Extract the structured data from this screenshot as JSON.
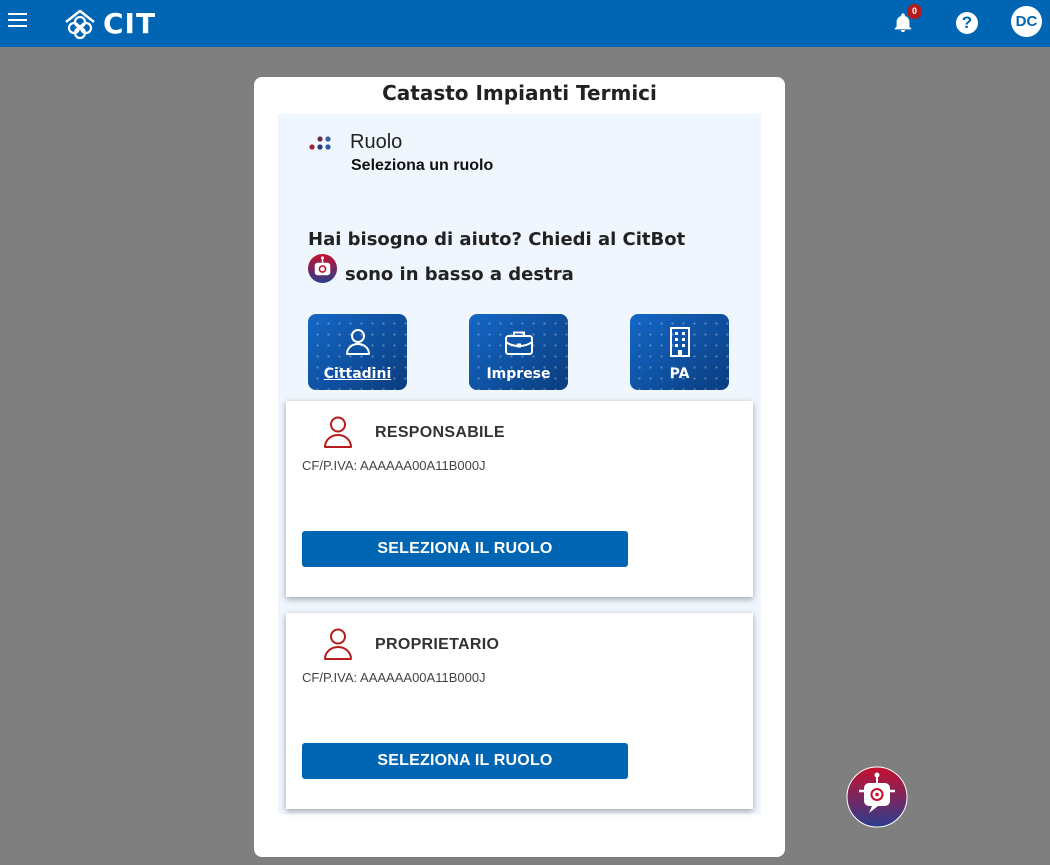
{
  "header": {
    "logo_text": "CIT",
    "notifications_count": "0",
    "help_label": "?",
    "user_initials": "DC"
  },
  "panel": {
    "title": "Catasto Impianti Termici",
    "ruolo_title": "Ruolo",
    "ruolo_subtitle": "Seleziona un ruolo",
    "help_line1": "Hai bisogno di aiuto? Chiedi al CitBot",
    "help_line2": "sono in basso a destra"
  },
  "categories": [
    {
      "label": "Cittadini",
      "icon": "person-icon",
      "active": true
    },
    {
      "label": "Imprese",
      "icon": "briefcase-icon",
      "active": false
    },
    {
      "label": "PA",
      "icon": "building-icon",
      "active": false
    }
  ],
  "roles": [
    {
      "name": "RESPONSABILE",
      "cf": "CF/P.IVA: AAAAAA00A11B000J",
      "button": "SELEZIONA IL RUOLO"
    },
    {
      "name": "PROPRIETARIO",
      "cf": "CF/P.IVA: AAAAAA00A11B000J",
      "button": "SELEZIONA IL RUOLO"
    }
  ],
  "colors": {
    "primary": "#0066b3",
    "background": "#7f7f7f",
    "accent_red": "#b71c1c"
  }
}
